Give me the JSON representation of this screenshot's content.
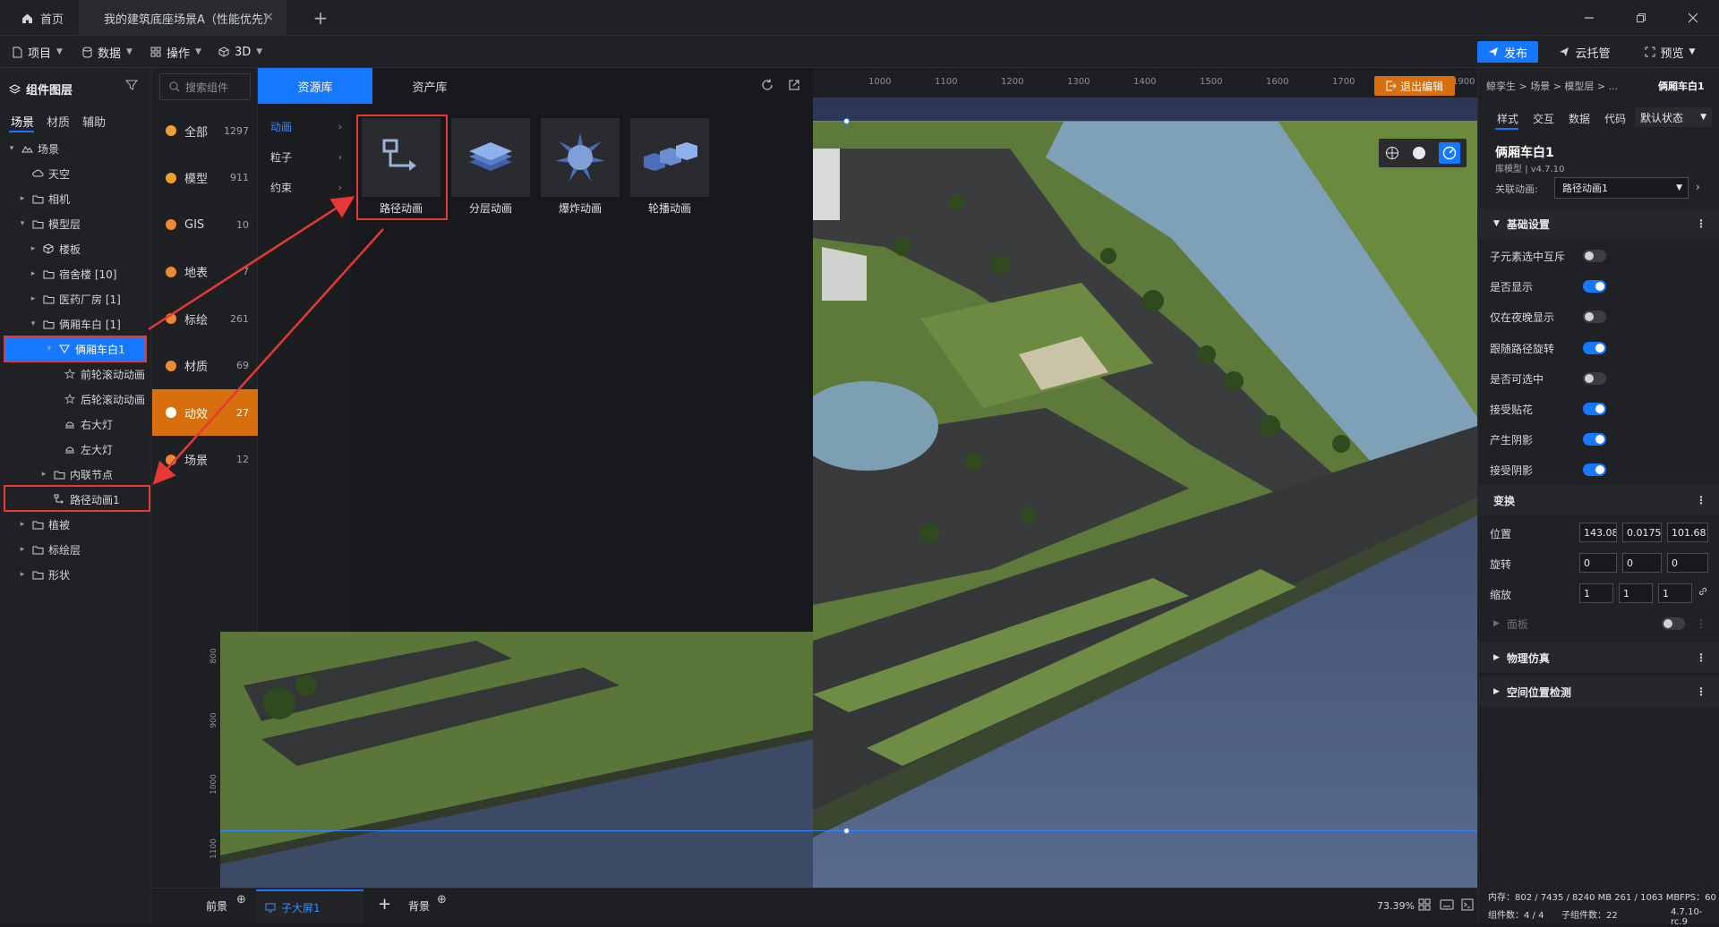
{
  "titlebar": {
    "home_tab": "首页",
    "scene_tab": "我的建筑底座场景A（性能优先）",
    "close": "×",
    "add": "+"
  },
  "toolbar": {
    "project": "项目",
    "data": "数据",
    "operate": "操作",
    "mode_3d": "3D",
    "publish": "发布",
    "cloud": "云托管",
    "preview": "预览"
  },
  "layers": {
    "title": "组件图层",
    "tabs": [
      "场景",
      "材质",
      "辅助"
    ],
    "tree": [
      {
        "label": "场景",
        "depth": 0,
        "arrow": "▾",
        "icon": "scene"
      },
      {
        "label": "天空",
        "depth": 1,
        "arrow": "",
        "icon": "sky"
      },
      {
        "label": "相机",
        "depth": 1,
        "arrow": "▸",
        "icon": "folder"
      },
      {
        "label": "模型层",
        "depth": 1,
        "arrow": "▾",
        "icon": "folder"
      },
      {
        "label": "楼板",
        "depth": 2,
        "arrow": "▸",
        "icon": "cube"
      },
      {
        "label": "宿舍楼 [10]",
        "depth": 2,
        "arrow": "▸",
        "icon": "folder"
      },
      {
        "label": "医药厂房 [1]",
        "depth": 2,
        "arrow": "▸",
        "icon": "folder"
      },
      {
        "label": "俩厢车白 [1]",
        "depth": 2,
        "arrow": "▾",
        "icon": "folder"
      },
      {
        "label": "俩厢车白1",
        "depth": 3,
        "arrow": "▾",
        "icon": "model",
        "selected": true
      },
      {
        "label": "前轮滚动动画",
        "depth": 4,
        "arrow": "",
        "icon": "star"
      },
      {
        "label": "后轮滚动动画",
        "depth": 4,
        "arrow": "",
        "icon": "star"
      },
      {
        "label": "右大灯",
        "depth": 4,
        "arrow": "",
        "icon": "light"
      },
      {
        "label": "左大灯",
        "depth": 4,
        "arrow": "",
        "icon": "light"
      },
      {
        "label": "内联节点",
        "depth": 3,
        "arrow": "▸",
        "icon": "folder"
      },
      {
        "label": "路径动画1",
        "depth": 3,
        "arrow": "",
        "icon": "path"
      },
      {
        "label": "植被",
        "depth": 1,
        "arrow": "▸",
        "icon": "folder"
      },
      {
        "label": "标绘层",
        "depth": 1,
        "arrow": "▸",
        "icon": "folder"
      },
      {
        "label": "形状",
        "depth": 1,
        "arrow": "▸",
        "icon": "folder"
      }
    ]
  },
  "categories": {
    "search_placeholder": "搜索组件",
    "items": [
      {
        "label": "全部",
        "count": "1297",
        "color": "#f0a030"
      },
      {
        "label": "模型",
        "count": "911",
        "color": "#f0a030"
      },
      {
        "label": "GIS",
        "count": "10",
        "color": "#f08a30"
      },
      {
        "label": "地表",
        "count": "7",
        "color": "#f08a30"
      },
      {
        "label": "标绘",
        "count": "261",
        "color": "#f08a30"
      },
      {
        "label": "材质",
        "count": "69",
        "color": "#f08a30"
      },
      {
        "label": "动效",
        "count": "27",
        "color": "#ffffff",
        "active": true
      },
      {
        "label": "场景",
        "count": "12",
        "color": "#f08a30"
      }
    ]
  },
  "resources": {
    "tab_library": "资源库",
    "tab_assets": "资产库",
    "subcats": [
      {
        "label": "动画",
        "active": true
      },
      {
        "label": "粒子"
      },
      {
        "label": "约束"
      }
    ],
    "assets": [
      {
        "label": "路径动画",
        "icon": "path-anim-icon"
      },
      {
        "label": "分层动画",
        "icon": "layer-anim-icon"
      },
      {
        "label": "爆炸动画",
        "icon": "explode-anim-icon"
      },
      {
        "label": "轮播动画",
        "icon": "carousel-anim-icon"
      }
    ]
  },
  "viewport": {
    "ruler_top": [
      "1000",
      "1100",
      "1200",
      "1300",
      "1400",
      "1500",
      "1600",
      "1700",
      "1900"
    ],
    "ruler_left": [
      "800",
      "900",
      "1000",
      "1100"
    ],
    "exit_edit": "退出编辑"
  },
  "bottom": {
    "front": "前景",
    "screen_tab": "子大屏1",
    "add": "+",
    "back": "背景",
    "zoom": "73.39%"
  },
  "props": {
    "breadcrumb": "鲸孪生 > 场景 > 模型层 > ...",
    "name_top": "俩厢车白1",
    "tabs": [
      "样式",
      "交互",
      "数据",
      "代码"
    ],
    "state_select": "默认状态",
    "title": "俩厢车白1",
    "subtitle": "库模型 | v4.7.10",
    "linked_label": "关联动画:",
    "linked_value": "路径动画1",
    "basic_section": "基础设置",
    "toggles": [
      {
        "label": "子元素选中互斥",
        "on": false
      },
      {
        "label": "是否显示",
        "on": true
      },
      {
        "label": "仅在夜晚显示",
        "on": false
      },
      {
        "label": "跟随路径旋转",
        "on": true
      },
      {
        "label": "是否可选中",
        "on": false
      },
      {
        "label": "接受贴花",
        "on": true
      },
      {
        "label": "产生阴影",
        "on": true
      },
      {
        "label": "接受阴影",
        "on": true
      }
    ],
    "transform_section": "变换",
    "position_label": "位置",
    "position": [
      "143.085",
      "0.01750",
      "101.681"
    ],
    "rotation_label": "旋转",
    "rotation": [
      "0",
      "0",
      "0"
    ],
    "scale_label": "缩放",
    "scale": [
      "1",
      "1",
      "1"
    ],
    "panel_section": "面板",
    "physics_section": "物理仿真",
    "spatial_section": "空间位置检测",
    "status_memory": "内存：802 / 7435 / 8240 MB 261 / 1063 MB",
    "status_fps": "FPS：60",
    "status_components": "组件数：4 / 4",
    "status_children": "子组件数：22",
    "status_version": "4.7.10-rc.9"
  }
}
